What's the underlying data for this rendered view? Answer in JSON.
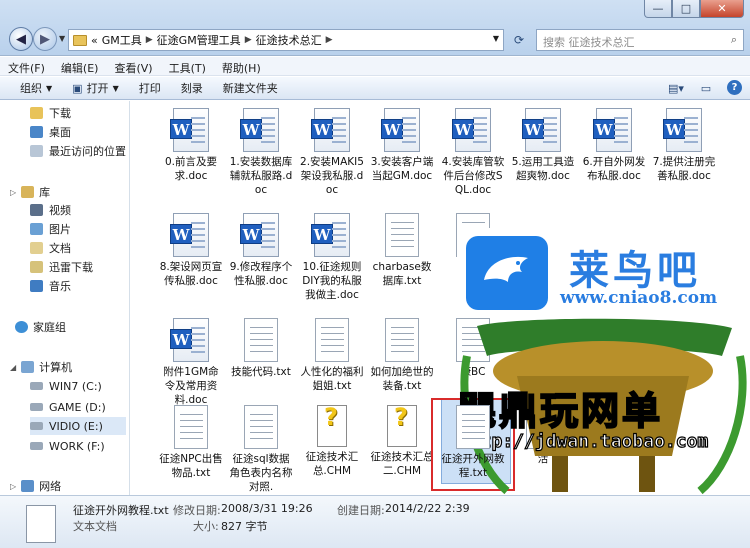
{
  "window": {
    "min": "—",
    "max": "□",
    "close": "✕"
  },
  "address": {
    "overflow": "«",
    "crumbs": [
      "GM工具",
      "征途GM管理工具",
      "征途技术总汇"
    ]
  },
  "search": {
    "placeholder": "搜索 征途技术总汇"
  },
  "menu": [
    "文件(F)",
    "编辑(E)",
    "查看(V)",
    "工具(T)",
    "帮助(H)"
  ],
  "toolbar": {
    "organize": "组织",
    "open": "打开",
    "print": "打印",
    "burn": "刻录",
    "newfolder": "新建文件夹"
  },
  "nav": {
    "favorites": [
      "下载",
      "桌面",
      "最近访问的位置"
    ],
    "library": "库",
    "libs": [
      "视频",
      "图片",
      "文档",
      "迅雷下载",
      "音乐"
    ],
    "homegroup": "家庭组",
    "computer": "计算机",
    "drives": [
      "WIN7 (C:)",
      "GAME (D:)",
      "VIDIO (E:)",
      "WORK (F:)"
    ],
    "network": "网络"
  },
  "files": [
    {
      "name": "0.前言及要求.doc",
      "type": "doc"
    },
    {
      "name": "1.安装数据库辅就私服路.doc",
      "type": "doc"
    },
    {
      "name": "2.安装MAKI5 架设我私服.doc",
      "type": "doc"
    },
    {
      "name": "3.安装客户端当起GM.doc",
      "type": "doc"
    },
    {
      "name": "4.安装库管软件后台修改SQL.doc",
      "type": "doc"
    },
    {
      "name": "5.运用工具造超爽物.doc",
      "type": "doc"
    },
    {
      "name": "6.开自外网发布私服.doc",
      "type": "doc"
    },
    {
      "name": "7.提供注册完善私服.doc",
      "type": "doc"
    },
    {
      "name": "8.架设网页宣传私服.doc",
      "type": "doc"
    },
    {
      "name": "9.修改程序个性私服.doc",
      "type": "doc"
    },
    {
      "name": "10.征途规则DIY我的私服我做主.doc",
      "type": "doc"
    },
    {
      "name": "charbase数据库.txt",
      "type": "txt"
    },
    {
      "name": "GI",
      "type": "txt"
    },
    {
      "name": "附件1GM命令及常用资料.doc",
      "type": "doc"
    },
    {
      "name": "技能代码.txt",
      "type": "txt"
    },
    {
      "name": "人性化的福利姐姐.txt",
      "type": "txt"
    },
    {
      "name": "如何加绝世的装备.txt",
      "type": "txt"
    },
    {
      "name": "康BC",
      "type": "txt"
    },
    {
      "name": "征途NPC出售物品.txt",
      "type": "txt"
    },
    {
      "name": "征途sql数据角色表内名称对照.",
      "type": "txt"
    },
    {
      "name": "征途技术汇总.CHM",
      "type": "chm"
    },
    {
      "name": "征途技术汇总二.CHM",
      "type": "chm"
    },
    {
      "name": "征途开外网教程.txt",
      "type": "txt"
    },
    {
      "name": "活",
      "type": "txt"
    }
  ],
  "status": {
    "filename": "征途开外网教程.txt",
    "modified_label": "修改日期:",
    "modified": "2008/3/31 19:26",
    "created_label": "创建日期:",
    "created": "2014/2/22 2:39",
    "type": "文本文档",
    "size_label": "大小:",
    "size": "827 字节"
  },
  "watermark": {
    "site_name": "莱鸟吧",
    "site_url": "www.cniao8.com",
    "shop_name": "飓鼎玩网单",
    "shop_url": "http://jdwan.taobao.com"
  }
}
